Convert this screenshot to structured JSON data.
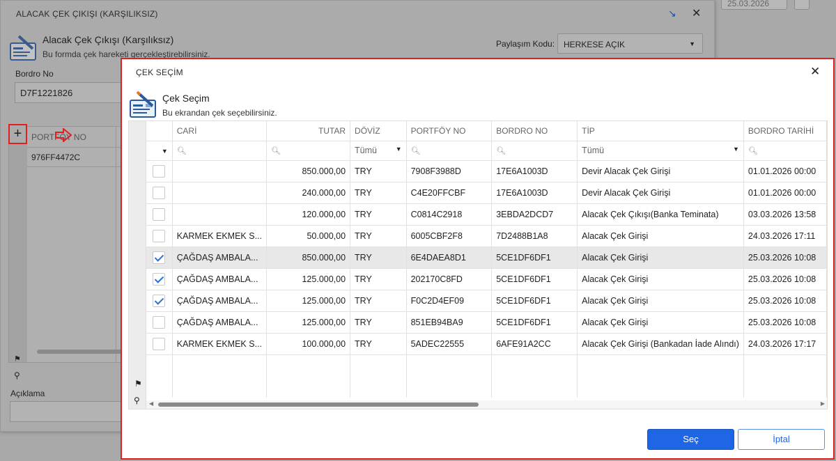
{
  "background": {
    "date_value": "25.03.2026"
  },
  "outer_dialog": {
    "title": "ALACAK ÇEK ÇIKIŞI (KARŞILIKSIZ)",
    "heading": "Alacak Çek Çıkışı (Karşılıksız)",
    "subheading": "Bu formda çek hareketi gerçekleştirebilirsiniz.",
    "share_label": "Paylaşım Kodu:",
    "share_value": "HERKESE AÇIK",
    "bordro_label": "Bordro No",
    "bordro_value": "D7F1221826",
    "add_label": "+",
    "grid_header": "PORTFÖY NO",
    "grid_row": "976FF4472C",
    "aciklama_label": "Açıklama",
    "shrink_icon": "collapse-arrow-icon",
    "close_icon": "close-icon"
  },
  "dialog": {
    "title": "ÇEK SEÇİM",
    "heading": "Çek Seçim",
    "subheading": "Bu ekrandan çek seçebilirsiniz.",
    "close_icon": "close-icon",
    "accent_color": "#1f66e5",
    "highlight_color": "#e02020"
  },
  "grid": {
    "columns": [
      "CARİ",
      "TUTAR",
      "DÖVİZ",
      "PORTFÖY NO",
      "BORDRO NO",
      "TİP",
      "BORDRO TARİHİ"
    ],
    "filters": {
      "doviz": "Tümü",
      "tip": "Tümü"
    },
    "rows": [
      {
        "checked": false,
        "cari": "",
        "tutar": "850.000,00",
        "doviz": "TRY",
        "portfoy": "7908F3988D",
        "bordro": "17E6A1003D",
        "tip": "Devir Alacak Çek Girişi",
        "tarih": "01.01.2026 00:00"
      },
      {
        "checked": false,
        "cari": "",
        "tutar": "240.000,00",
        "doviz": "TRY",
        "portfoy": "C4E20FFCBF",
        "bordro": "17E6A1003D",
        "tip": "Devir Alacak Çek Girişi",
        "tarih": "01.01.2026 00:00"
      },
      {
        "checked": false,
        "cari": "",
        "tutar": "120.000,00",
        "doviz": "TRY",
        "portfoy": "C0814C2918",
        "bordro": "3EBDA2DCD7",
        "tip": "Alacak Çek Çıkışı(Banka Teminata)",
        "tarih": "03.03.2026 13:58"
      },
      {
        "checked": false,
        "cari": "KARMEK EKMEK S...",
        "tutar": "50.000,00",
        "doviz": "TRY",
        "portfoy": "6005CBF2F8",
        "bordro": "7D2488B1A8",
        "tip": "Alacak Çek Girişi",
        "tarih": "24.03.2026 17:11"
      },
      {
        "checked": true,
        "cari": "ÇAĞDAŞ AMBALA...",
        "tutar": "850.000,00",
        "doviz": "TRY",
        "portfoy": "6E4DAEA8D1",
        "bordro": "5CE1DF6DF1",
        "tip": "Alacak Çek Girişi",
        "tarih": "25.03.2026 10:08"
      },
      {
        "checked": true,
        "cari": "ÇAĞDAŞ AMBALA...",
        "tutar": "125.000,00",
        "doviz": "TRY",
        "portfoy": "202170C8FD",
        "bordro": "5CE1DF6DF1",
        "tip": "Alacak Çek Girişi",
        "tarih": "25.03.2026 10:08"
      },
      {
        "checked": true,
        "cari": "ÇAĞDAŞ AMBALA...",
        "tutar": "125.000,00",
        "doviz": "TRY",
        "portfoy": "F0C2D4EF09",
        "bordro": "5CE1DF6DF1",
        "tip": "Alacak Çek Girişi",
        "tarih": "25.03.2026 10:08"
      },
      {
        "checked": false,
        "cari": "ÇAĞDAŞ AMBALA...",
        "tutar": "125.000,00",
        "doviz": "TRY",
        "portfoy": "851EB94BA9",
        "bordro": "5CE1DF6DF1",
        "tip": "Alacak Çek Girişi",
        "tarih": "25.03.2026 10:08"
      },
      {
        "checked": false,
        "cari": "KARMEK EKMEK S...",
        "tutar": "100.000,00",
        "doviz": "TRY",
        "portfoy": "5ADEC22555",
        "bordro": "6AFE91A2CC",
        "tip": "Alacak Çek Girişi (Bankadan İade Alındı)",
        "tarih": "24.03.2026 17:17"
      }
    ],
    "selected_row": 4
  },
  "buttons": {
    "select": "Seç",
    "cancel": "İptal"
  }
}
